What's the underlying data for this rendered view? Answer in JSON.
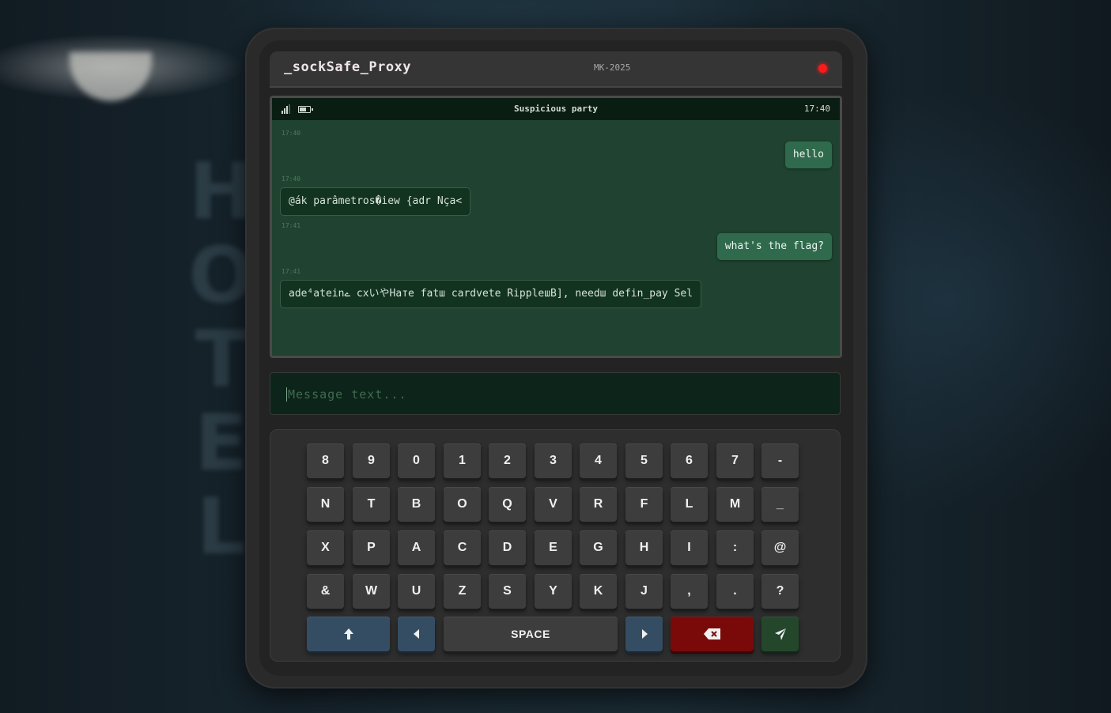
{
  "background": {
    "sign_letters": [
      "H",
      "O",
      "T",
      "E",
      "L"
    ]
  },
  "device": {
    "brand": "_sockSafe_Proxy",
    "model": "MK-2025",
    "status_light_color": "#ff1a1a"
  },
  "screen": {
    "chat_title": "Suspicious party",
    "clock": "17:40",
    "messages": [
      {
        "time": "17:40",
        "direction": "out",
        "text": "hello"
      },
      {
        "time": "17:40",
        "direction": "in",
        "text": "@ák parâmetros�iew {adr Nça<"
      },
      {
        "time": "17:41",
        "direction": "out",
        "text": "what's the flag?"
      },
      {
        "time": "17:41",
        "direction": "in",
        "text": "ade⁴ateinے cxいやHате fatш cardvete RippleшB], needш defin_pay Sel"
      }
    ]
  },
  "input": {
    "placeholder": "Message text...",
    "value": ""
  },
  "keyboard": {
    "rows": [
      [
        "8",
        "9",
        "0",
        "1",
        "2",
        "3",
        "4",
        "5",
        "6",
        "7",
        "-"
      ],
      [
        "N",
        "T",
        "B",
        "O",
        "Q",
        "V",
        "R",
        "F",
        "L",
        "M",
        "_"
      ],
      [
        "X",
        "P",
        "A",
        "C",
        "D",
        "E",
        "G",
        "H",
        "I",
        ":",
        "@"
      ],
      [
        "&",
        "W",
        "U",
        "Z",
        "S",
        "Y",
        "K",
        "J",
        ",",
        ".",
        "?"
      ]
    ],
    "space_label": "SPACE",
    "icons": {
      "shift": "arrow-up-icon",
      "left": "caret-left-icon",
      "right": "caret-right-icon",
      "backspace": "backspace-icon",
      "send": "send-icon"
    },
    "colors": {
      "shift": "#354d63",
      "backspace": "#7a0a0a",
      "send": "#24472c"
    }
  }
}
